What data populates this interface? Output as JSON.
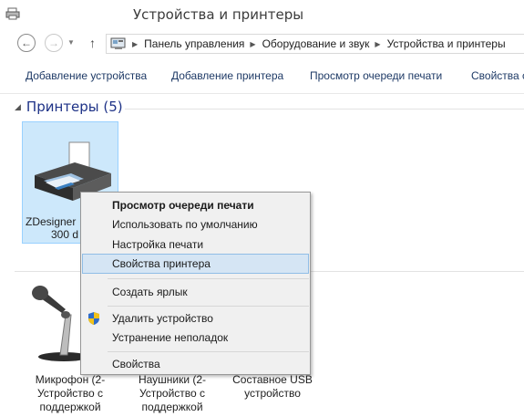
{
  "window": {
    "title": "Устройства и принтеры"
  },
  "address_bar": {
    "crumbs": [
      "Панель управления",
      "Оборудование и звук",
      "Устройства и принтеры"
    ]
  },
  "command_bar": {
    "items": [
      "Добавление устройства",
      "Добавление принтера",
      "Просмотр очереди печати",
      "Свойства с"
    ]
  },
  "printers_group": {
    "title": "Принтеры (5)",
    "selected_label_line1": "ZDesigner",
    "selected_label_line2": "300 d"
  },
  "devices": [
    {
      "line1": "Микрофон (2-",
      "line2": "Устройство с",
      "line3": "поддержкой"
    },
    {
      "line1": "Наушники (2-",
      "line2": "Устройство с",
      "line3": "поддержкой"
    },
    {
      "line1": "Составное USB",
      "line2": "устройство",
      "line3": ""
    }
  ],
  "context_menu": {
    "items": [
      {
        "label": "Просмотр очереди печати",
        "bold": true
      },
      {
        "label": "Использовать по умолчанию"
      },
      {
        "label": "Настройка печати"
      },
      {
        "label": "Свойства принтера",
        "highlighted": true
      },
      {
        "label": "Создать ярлык"
      },
      {
        "label": "Удалить устройство",
        "icon": "uac-shield-icon"
      },
      {
        "label": "Устранение неполадок"
      },
      {
        "label": "Свойства"
      }
    ]
  },
  "colors": {
    "group_title": "#1e3287",
    "command_text": "#1e3a66",
    "selection_fill": "#cde8fb",
    "menu_highlight": "#d5e5f4"
  }
}
